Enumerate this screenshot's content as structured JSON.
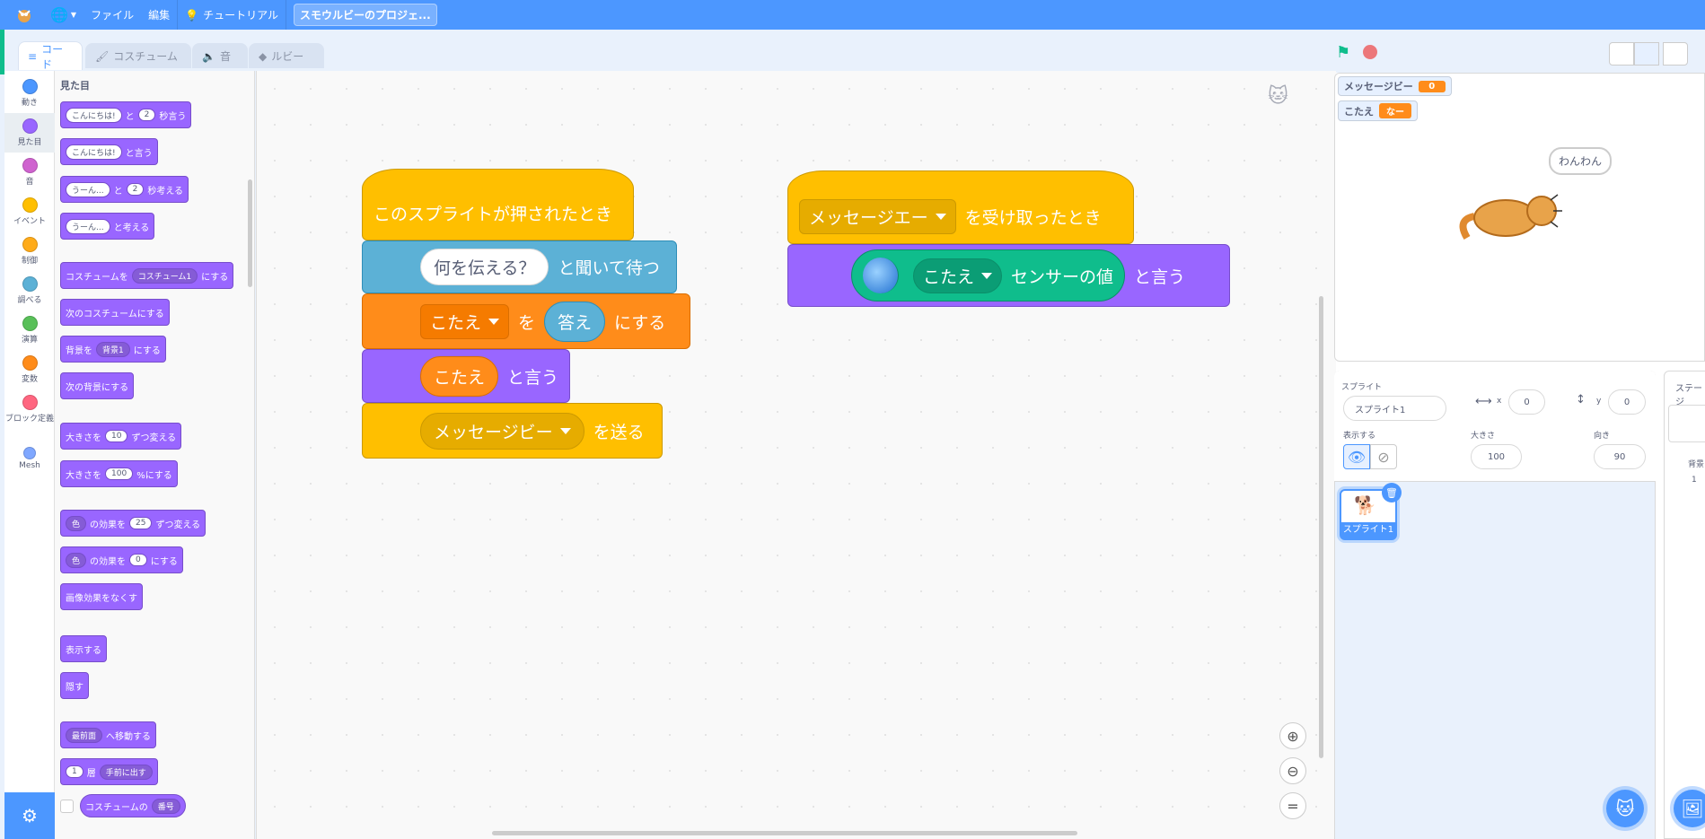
{
  "menubar": {
    "file": "ファイル",
    "edit": "編集",
    "tutorial": "チュートリアル",
    "project_title": "スモウルビーのプロジェ..."
  },
  "tabs": {
    "code": "コード",
    "costume": "コスチューム",
    "sound": "音",
    "ruby": "ルビー"
  },
  "categories": [
    {
      "label": "動き",
      "color": "#4c97ff"
    },
    {
      "label": "見た目",
      "color": "#9966ff"
    },
    {
      "label": "音",
      "color": "#cf63cf"
    },
    {
      "label": "イベント",
      "color": "#ffbf00"
    },
    {
      "label": "制御",
      "color": "#ffab19"
    },
    {
      "label": "調べる",
      "color": "#5cb1d6"
    },
    {
      "label": "演算",
      "color": "#59c059"
    },
    {
      "label": "変数",
      "color": "#ff8c1a"
    },
    {
      "label": "ブロック定義",
      "color": "#ff6680"
    },
    {
      "label": "Mesh",
      "color": "#7fa7ff"
    }
  ],
  "palette": {
    "heading": "見た目",
    "say_secs": {
      "in": "こんにちは!",
      "t1": "と",
      "num": "2",
      "t2": "秒言う"
    },
    "say": {
      "in": "こんにちは!",
      "t": "と言う"
    },
    "think_secs": {
      "in": "うーん...",
      "t1": "と",
      "num": "2",
      "t2": "秒考える"
    },
    "think": {
      "in": "うーん...",
      "t": "と考える"
    },
    "switch_costume": {
      "t1": "コスチュームを",
      "dd": "コスチューム1",
      "t2": "にする"
    },
    "next_costume": "次のコスチュームにする",
    "switch_backdrop": {
      "t1": "背景を",
      "dd": "背景1",
      "t2": "にする"
    },
    "next_backdrop": "次の背景にする",
    "change_size": {
      "t1": "大きさを",
      "num": "10",
      "t2": "ずつ変える"
    },
    "set_size": {
      "t1": "大きさを",
      "num": "100",
      "t2": "%にする"
    },
    "change_effect": {
      "dd": "色",
      "t1": "の効果を",
      "num": "25",
      "t2": "ずつ変える"
    },
    "set_effect": {
      "dd": "色",
      "t1": "の効果を",
      "num": "0",
      "t2": "にする"
    },
    "clear_effects": "画像効果をなくす",
    "show": "表示する",
    "hide": "隠す",
    "goto_layer": {
      "dd": "最前面",
      "t": "へ移動する"
    },
    "go_layers": {
      "num": "1",
      "t": "層",
      "dd": "手前に出す"
    },
    "costume_reporter": {
      "t": "コスチュームの",
      "dd": "番号"
    }
  },
  "script1": {
    "hat": "このスプライトが押されたとき",
    "ask_input": "何を伝える？",
    "ask_text": "と聞いて待つ",
    "set_var": "こたえ",
    "set_to": "を",
    "answer": "答え",
    "set_end": "にする",
    "say_var": "こたえ",
    "say_text": "と言う",
    "broadcast_msg": "メッセージビー",
    "broadcast_text": "を送る"
  },
  "script2": {
    "hat_msg": "メッセージエー",
    "hat_text": "を受け取ったとき",
    "sensor_var": "こたえ",
    "sensor_text": "センサーの値",
    "say_text": "と言う"
  },
  "monitors": [
    {
      "label": "メッセージビー",
      "value": "0"
    },
    {
      "label": "こたえ",
      "value": "なー"
    }
  ],
  "stage_bubble": "わんわん",
  "sprite_info": {
    "sprite_label": "スプライト",
    "sprite_name": "スプライト1",
    "x_label": "x",
    "x": "0",
    "y_label": "y",
    "y": "0",
    "show_label": "表示する",
    "size_label": "大きさ",
    "size": "100",
    "dir_label": "向き",
    "direction": "90"
  },
  "sprite_thumb": "スプライト1",
  "stage_pane": {
    "label": "ステージ",
    "backdrop_label": "背景",
    "backdrop_count": "1"
  }
}
